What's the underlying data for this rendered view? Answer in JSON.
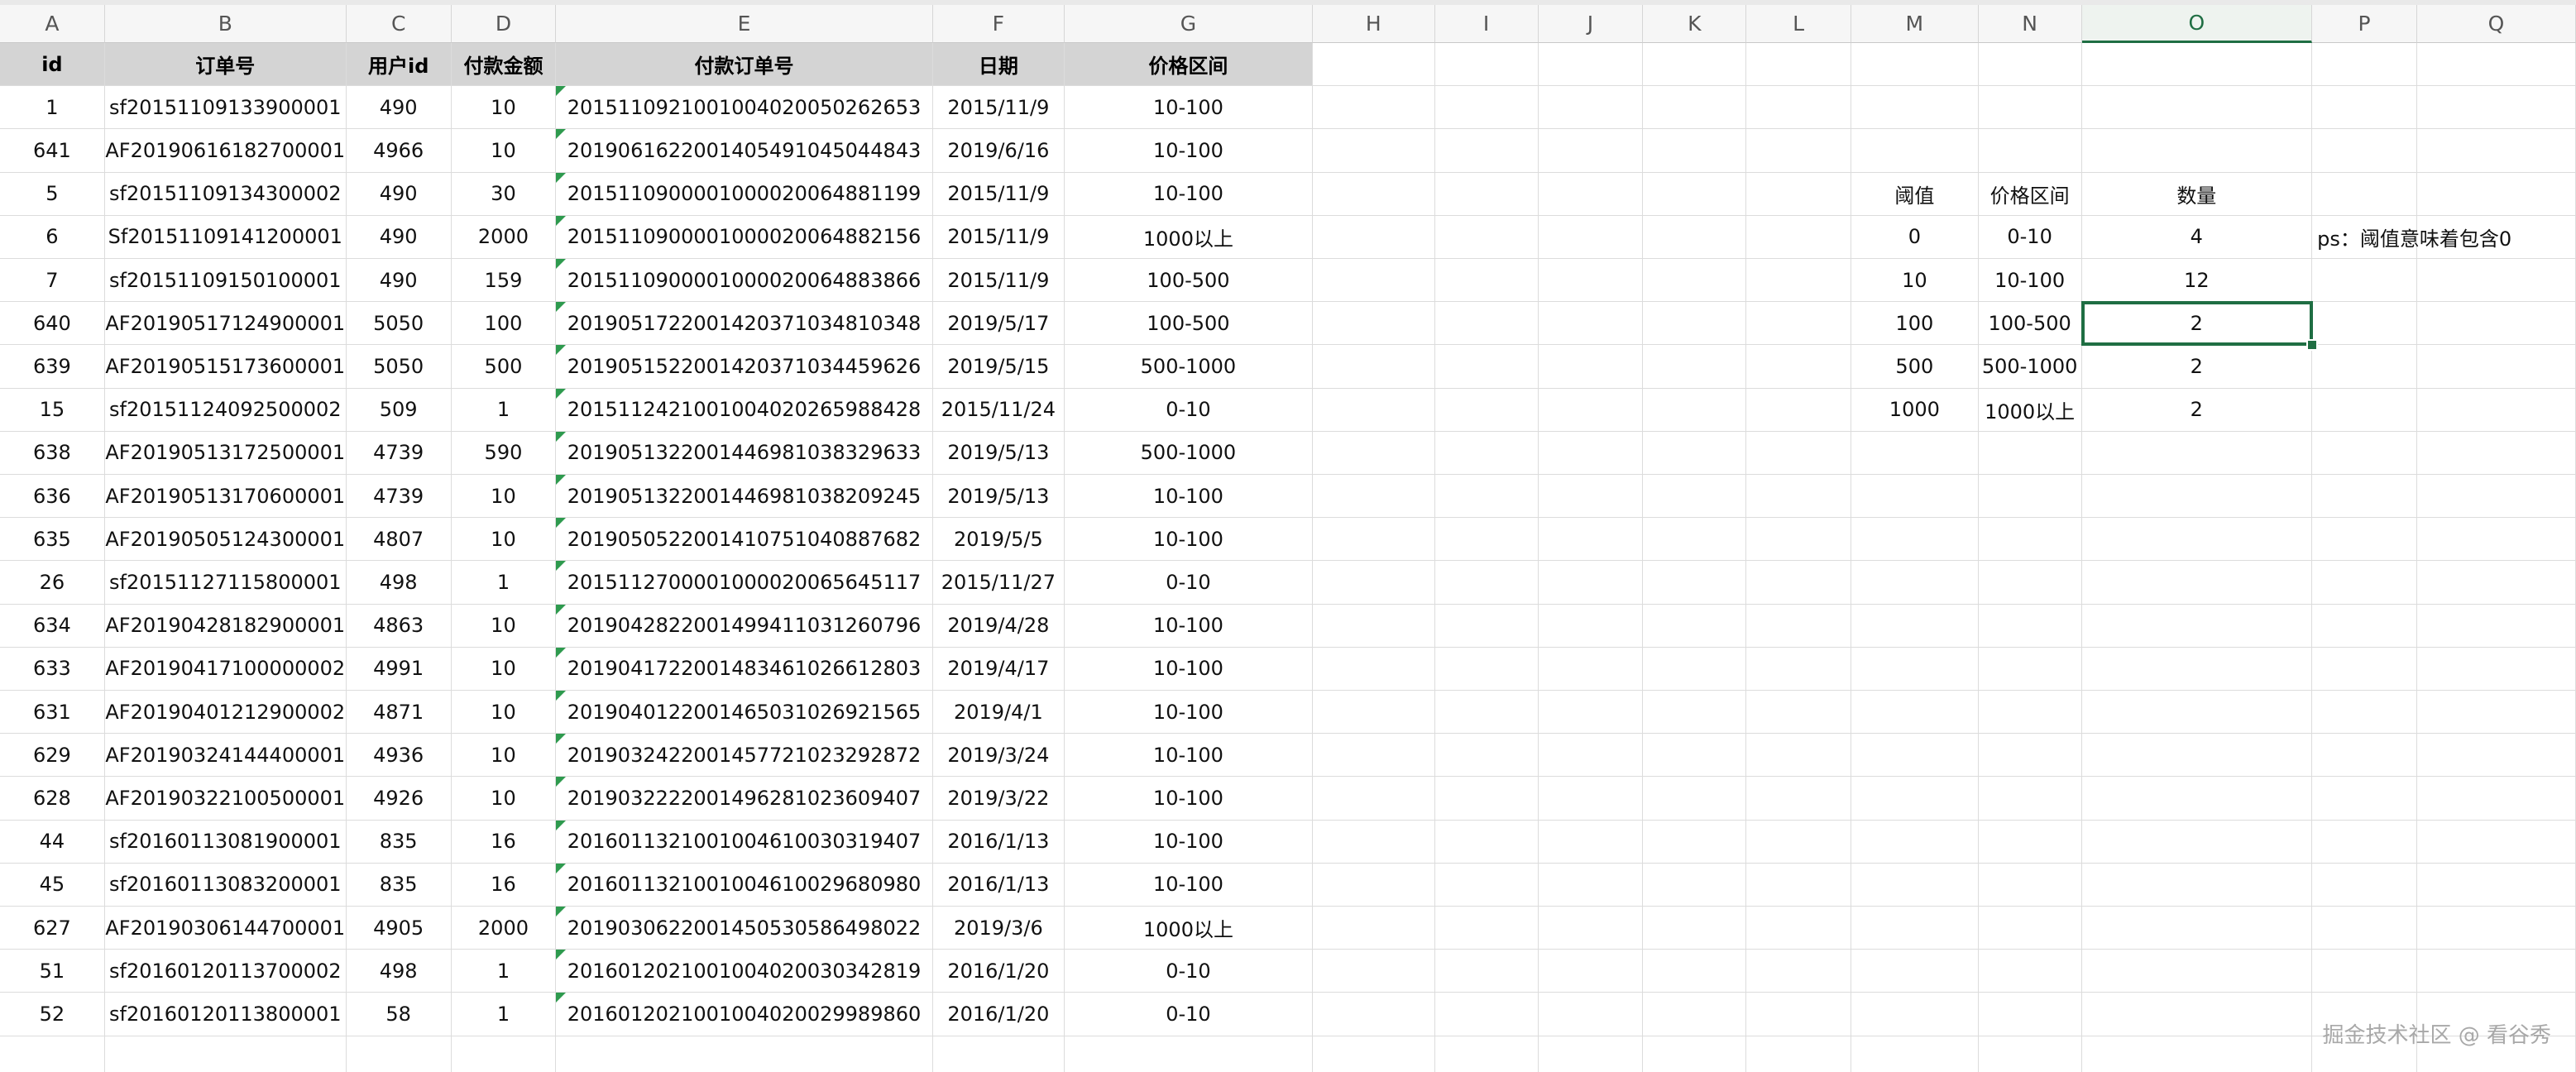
{
  "columns": [
    "A",
    "B",
    "C",
    "D",
    "E",
    "F",
    "G",
    "H",
    "I",
    "J",
    "K",
    "L",
    "M",
    "N",
    "O",
    "P",
    "Q"
  ],
  "active_column": "O",
  "table": {
    "headers": [
      "id",
      "订单号",
      "用户id",
      "付款金额",
      "付款订单号",
      "日期",
      "价格区间"
    ],
    "rows": [
      [
        "1",
        "sf20151109133900001",
        "490",
        "10",
        "20151109210010040200502626 53",
        "2015/11/9",
        "10-100"
      ],
      [
        "641",
        "AF20190616182700001",
        "4966",
        "10",
        "20190616220014054910450448 43",
        "2019/6/16",
        "10-100"
      ],
      [
        "5",
        "sf20151109134300002",
        "490",
        "30",
        "20151109000010000200648811 99",
        "2015/11/9",
        "10-100"
      ],
      [
        "6",
        "Sf20151109141200001",
        "490",
        "2000",
        "20151109000010000200648821 56",
        "2015/11/9",
        "1000以上"
      ],
      [
        "7",
        "sf20151109150100001",
        "490",
        "159",
        "20151109000010000200648838 66",
        "2015/11/9",
        "100-500"
      ],
      [
        "640",
        "AF20190517124900001",
        "5050",
        "100",
        "20190517220014203710348103 48",
        "2019/5/17",
        "100-500"
      ],
      [
        "639",
        "AF20190515173600001",
        "5050",
        "500",
        "20190515220014203710344596 26",
        "2019/5/15",
        "500-1000"
      ],
      [
        "15",
        "sf20151124092500002",
        "509",
        "1",
        "20151124210010040202659884 28",
        "2015/11/24",
        "0-10"
      ],
      [
        "638",
        "AF20190513172500001",
        "4739",
        "590",
        "20190513220014469810383296 33",
        "2019/5/13",
        "500-1000"
      ],
      [
        "636",
        "AF20190513170600001",
        "4739",
        "10",
        "20190513220014469810382092 45",
        "2019/5/13",
        "10-100"
      ],
      [
        "635",
        "AF20190505124300001",
        "4807",
        "10",
        "20190505220014107510408876 82",
        "2019/5/5",
        "10-100"
      ],
      [
        "26",
        "sf20151127115800001",
        "498",
        "1",
        "20151127000010000200656451 17",
        "2015/11/27",
        "0-10"
      ],
      [
        "634",
        "AF20190428182900001",
        "4863",
        "10",
        "20190428220014994110312607 96",
        "2019/4/28",
        "10-100"
      ],
      [
        "633",
        "AF20190417100000002",
        "4991",
        "10",
        "20190417220014834610266128 03",
        "2019/4/17",
        "10-100"
      ],
      [
        "631",
        "AF20190401212900002",
        "4871",
        "10",
        "20190401220014650310269215 65",
        "2019/4/1",
        "10-100"
      ],
      [
        "629",
        "AF20190324144400001",
        "4936",
        "10",
        "20190324220014577210232928 72",
        "2019/3/24",
        "10-100"
      ],
      [
        "628",
        "AF20190322100500001",
        "4926",
        "10",
        "20190322220014962810236094 07",
        "2019/3/22",
        "10-100"
      ],
      [
        "44",
        "sf20160113081900001",
        "835",
        "16",
        "20160113210010046100303194 07",
        "2016/1/13",
        "10-100"
      ],
      [
        "45",
        "sf20160113083200001",
        "835",
        "16",
        "20160113210010046100296809 80",
        "2016/1/13",
        "10-100"
      ],
      [
        "627",
        "AF20190306144700001",
        "4905",
        "2000",
        "20190306220014505305864980 22",
        "2019/3/6",
        "1000以上"
      ],
      [
        "51",
        "sf20160120113700002",
        "498",
        "1",
        "20160120210010040200303428 19",
        "2016/1/20",
        "0-10"
      ],
      [
        "52",
        "sf20160120113800001",
        "58",
        "1",
        "20160120210010040200299898 60",
        "2016/1/20",
        "0-10"
      ]
    ]
  },
  "summary": {
    "headers": [
      "阈值",
      "价格区间",
      "数量"
    ],
    "rows": [
      [
        "0",
        "0-10",
        "4"
      ],
      [
        "10",
        "10-100",
        "12"
      ],
      [
        "100",
        "100-500",
        "2"
      ],
      [
        "500",
        "500-1000",
        "2"
      ],
      [
        "1000",
        "1000以上",
        "2"
      ]
    ],
    "note": "ps：阈值意味着包含0"
  },
  "watermark": "掘金技术社区 @ 看谷秀"
}
